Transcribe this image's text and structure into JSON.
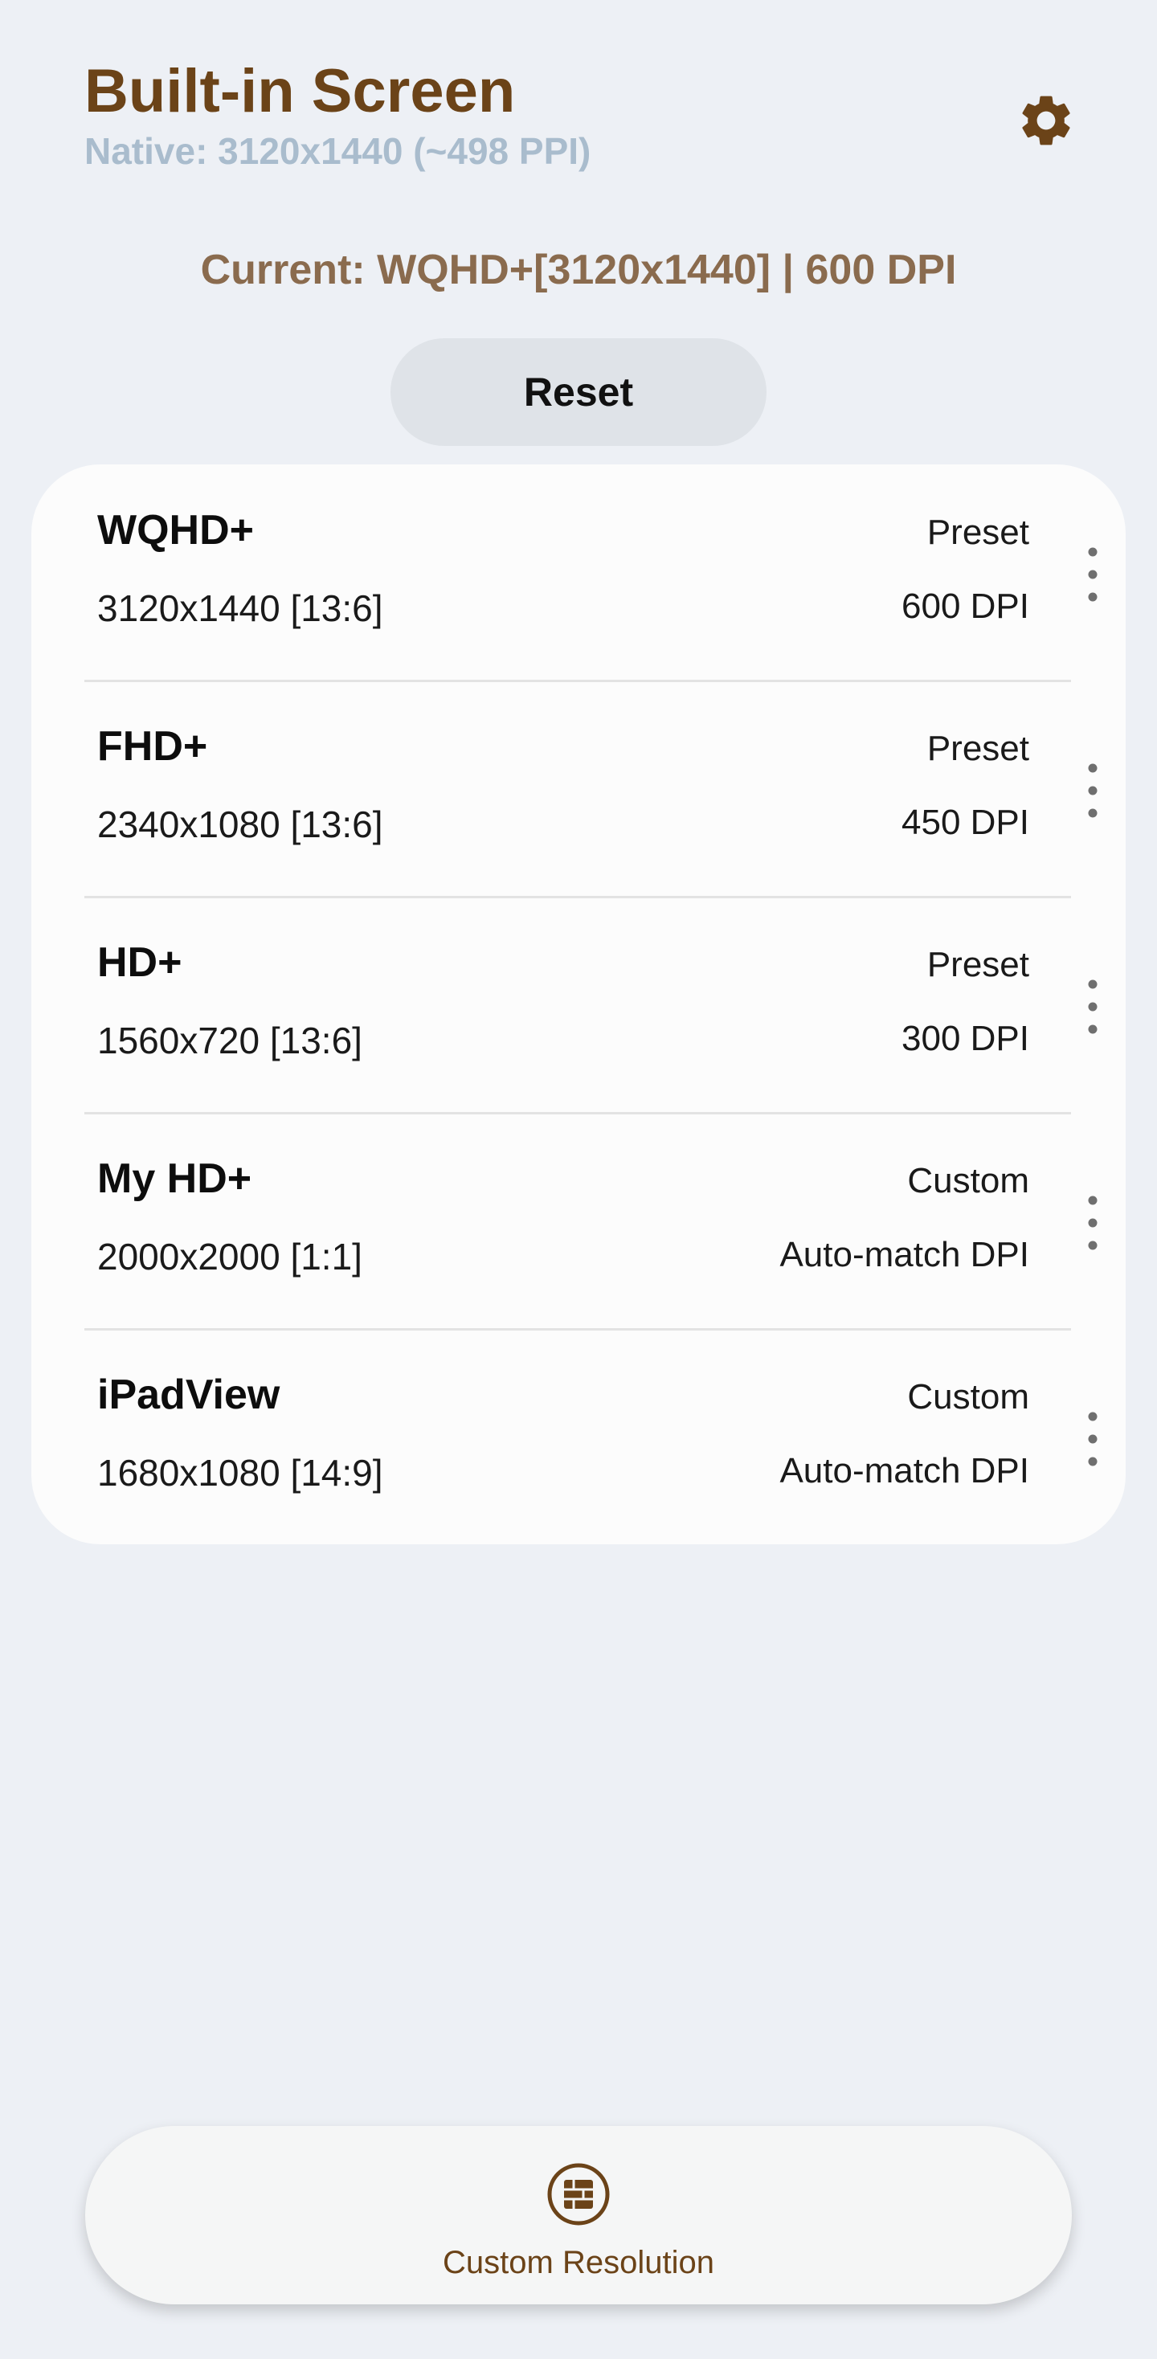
{
  "header": {
    "title": "Built-in Screen",
    "native": "Native: 3120x1440 (~498 PPI)",
    "settings_icon": "gear-icon"
  },
  "current": "Current: WQHD+[3120x1440] | 600 DPI",
  "reset_label": "Reset",
  "resolutions": [
    {
      "name": "WQHD+",
      "resolution": "3120x1440 [13:6]",
      "type": "Preset",
      "dpi": "600 DPI"
    },
    {
      "name": "FHD+",
      "resolution": "2340x1080 [13:6]",
      "type": "Preset",
      "dpi": "450 DPI"
    },
    {
      "name": "HD+",
      "resolution": "1560x720 [13:6]",
      "type": "Preset",
      "dpi": "300 DPI"
    },
    {
      "name": "My HD+",
      "resolution": "2000x2000 [1:1]",
      "type": "Custom",
      "dpi": "Auto-match DPI"
    },
    {
      "name": "iPadView",
      "resolution": "1680x1080 [14:9]",
      "type": "Custom",
      "dpi": "Auto-match DPI"
    }
  ],
  "bottom_nav": {
    "label": "Custom Resolution",
    "icon": "grid-icon"
  },
  "colors": {
    "title": "#6b4318",
    "native": "#a9bccd",
    "current": "#8a6b4e",
    "background": "#edf0f5",
    "card": "#fcfcfc"
  }
}
